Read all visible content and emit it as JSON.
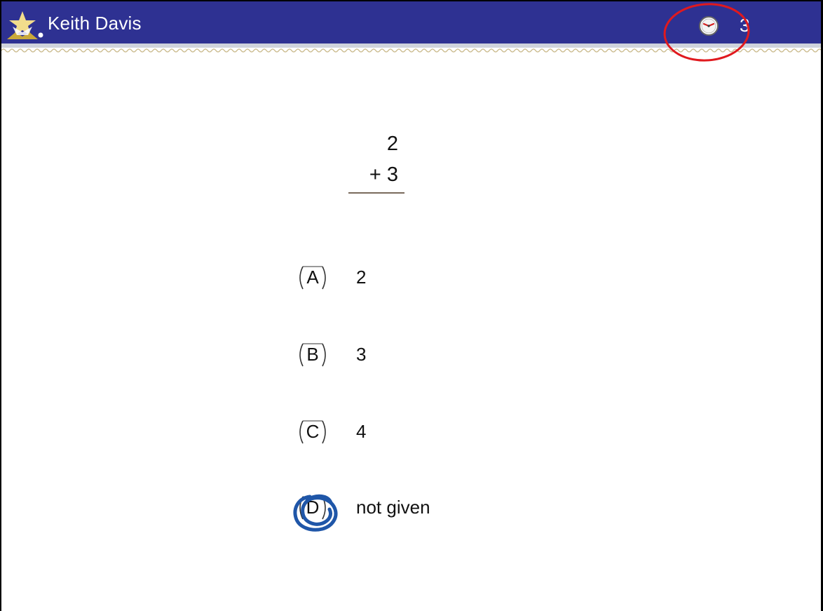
{
  "header": {
    "student_name": "Keith Davis",
    "timer_value": "3",
    "timer_icon": "clock-icon",
    "logo_icon": "star-logo-icon",
    "background_color": "#2e3192"
  },
  "problem": {
    "top_number": "2",
    "operator_line": "+ 3"
  },
  "choices": [
    {
      "letter": "A",
      "text": "2",
      "selected": false
    },
    {
      "letter": "B",
      "text": "3",
      "selected": false
    },
    {
      "letter": "C",
      "text": "4",
      "selected": false
    },
    {
      "letter": "D",
      "text": "not given",
      "selected": true
    }
  ],
  "annotations": {
    "timer_highlight_color": "#e0191e",
    "selection_mark_color": "#1f56a8"
  }
}
